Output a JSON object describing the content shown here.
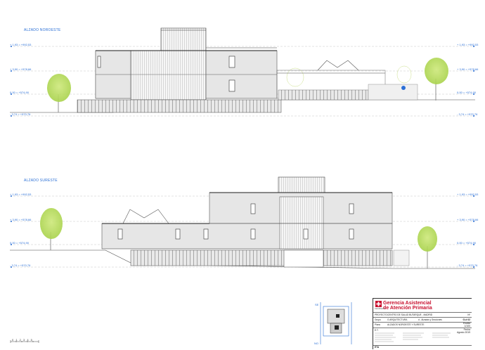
{
  "drawing": {
    "elevation_top_title": "ALZADO NOROESTE",
    "elevation_bottom_title": "ALZADO SURESTE",
    "levels_top_left": [
      "+ 1,93 = +992,53",
      "+ 3,90 = +578,66",
      "0,00 = +574,90",
      "- 3,74 = +570,76"
    ],
    "levels_top_right": [
      "+ 1,93 = +992,53",
      "+ 3,90 = +578,66",
      "0,00 = +574,90",
      "- 3,74 = +570,76"
    ],
    "levels_bottom_left": [
      "+ 1,93 = +992,53",
      "+ 3,90 = +578,66",
      "0,00 = +574,90",
      "- 3,74 = +570,76"
    ],
    "levels_bottom_right": [
      "+ 1,93 = +992,53",
      "+ 3,90 = +578,66",
      "0,00 = +574,90",
      "- 3,74 = +570,76"
    ],
    "scale_bar": "0 1 2 3 4 5"
  },
  "keyplan": {
    "label_left": "NO",
    "label_top": "SE"
  },
  "title_block": {
    "org_line1": "Gerencia Asistencial",
    "org_line2": "de Atención Primaria",
    "org_sub": "SaludMadrid",
    "project_label": "PROYECTO",
    "project_value": "CENTRO DE SALUD BUTARQUE - MADRID",
    "author_label": "Grupo",
    "author_value": "G ARQUITECTURA",
    "section_value": "d - Alzados y Secciones",
    "plane_label": "Plano",
    "plane_value": "ALZADOS NOROESTE Y SURESTE",
    "num_label": "Nº",
    "num_value": "G-d 02",
    "scale_label": "Escala",
    "scale_value": "1/100",
    "date_label": "Fecha",
    "date_value": "Agosto 2019",
    "team_label": "E.T.",
    "footer": "ETA"
  }
}
